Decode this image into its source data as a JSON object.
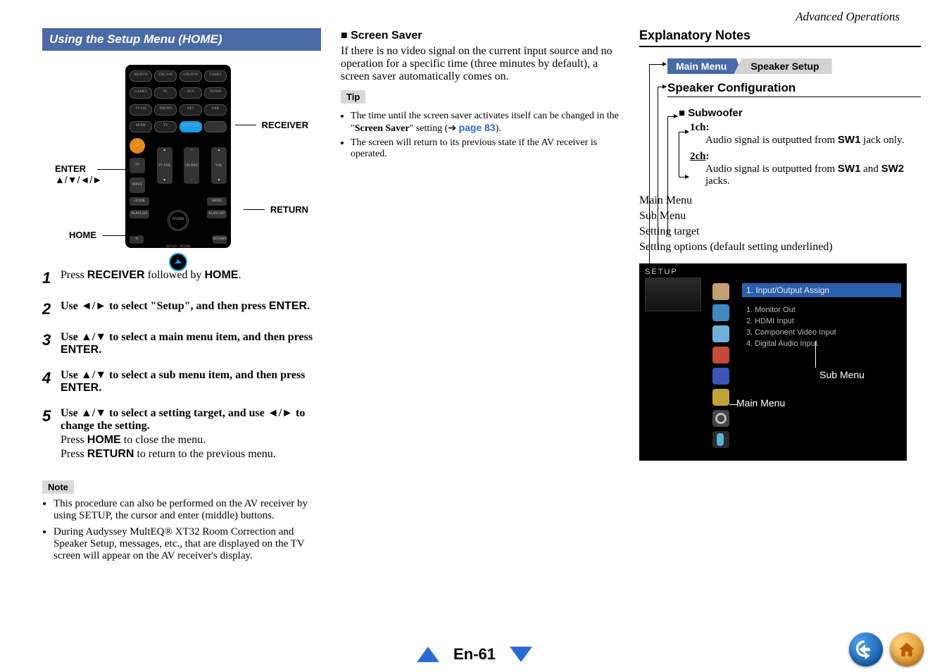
{
  "header": {
    "section": "Advanced Operations"
  },
  "col1": {
    "title": "Using the Setup Menu (HOME)",
    "remote_labels": {
      "receiver": "RECEIVER",
      "enter": "ENTER",
      "enter_sub": "▲/▼/◄/►",
      "return": "RETURN",
      "home": "HOME"
    },
    "steps": [
      {
        "n": "1",
        "body_pre": "Press ",
        "b1": "RECEIVER",
        "mid": " followed by ",
        "b2": "HOME",
        "post": "."
      },
      {
        "n": "2",
        "body_pre": "Use ",
        "b1": "◄",
        "mid1": "/",
        "b1b": "►",
        "mid": " to select \"Setup\", and then press ",
        "b2": "ENTER",
        "post": "."
      },
      {
        "n": "3",
        "body_pre": "Use ",
        "b1": "▲",
        "mid1": "/",
        "b1b": "▼",
        "mid": " to select a main menu item, and then press ",
        "b2": "ENTER",
        "post": "."
      },
      {
        "n": "4",
        "body_pre": "Use ",
        "b1": "▲",
        "mid1": "/",
        "b1b": "▼",
        "mid": " to select a sub menu item, and then press ",
        "b2": "ENTER",
        "post": "."
      },
      {
        "n": "5",
        "body_pre": "Use ",
        "b1": "▲",
        "mid1": "/",
        "b1b": "▼",
        "mid": " to select a setting target, and use ",
        "b2": "◄",
        "mid2": "/",
        "b2b": "►",
        "post": " to change the setting.",
        "extra1_pre": "Press ",
        "extra1_b": "HOME",
        "extra1_post": " to close the menu.",
        "extra2_pre": "Press ",
        "extra2_b": "RETURN",
        "extra2_post": " to return to the previous menu."
      }
    ],
    "note_label": "Note",
    "notes": [
      "This procedure can also be performed on the AV receiver by using SETUP, the cursor and enter (middle) buttons.",
      "During Audyssey MultEQ® XT32 Room Correction and Speaker Setup, messages, etc., that are displayed on the TV screen will appear on the AV receiver's display."
    ]
  },
  "col2": {
    "heading_prefix": "■",
    "heading": "Screen Saver",
    "body": "If there is no video signal on the current input source and no operation for a specific time (three minutes by default), a screen saver automatically comes on.",
    "tip_label": "Tip",
    "tips": [
      {
        "pre": "The time until the screen saver activates itself can be changed in the \"",
        "bold": "Screen Saver",
        "mid": "\" setting (➔ ",
        "link": "page 83",
        "post": ")."
      },
      {
        "pre": "The screen will return to its previous state if the AV receiver is operated."
      }
    ]
  },
  "col3": {
    "title": "Explanatory Notes",
    "tab_main": "Main Menu",
    "tab_second": "Speaker Setup",
    "sub_title": "Speaker Configuration",
    "sub_sub": "■ Subwoofer",
    "opt1": "1ch",
    "opt1_desc_pre": "Audio signal is outputted from ",
    "opt1_b": "SW1",
    "opt1_desc_post": " jack only.",
    "opt2": "2ch",
    "opt2_desc_pre": "Audio signal is outputted from ",
    "opt2_b1": "SW1",
    "opt2_mid": " and ",
    "opt2_b2": "SW2",
    "opt2_desc_post": " jacks.",
    "legend": {
      "a": "Main Menu",
      "b": "Sub Menu",
      "c": "Setting target",
      "d_pre": "Setting options (def",
      "d_post": "ault setting underlined)"
    },
    "setup": {
      "label": "SETUP",
      "title": "1. Input/Output Assign",
      "items": [
        "1. Monitor Out",
        "2. HDMI Input",
        "3. Component Video Input",
        "4. Digital Audio Input"
      ],
      "sub_label": "Sub Menu",
      "main_label": "Main Menu"
    }
  },
  "footer": {
    "page": "En-61"
  }
}
